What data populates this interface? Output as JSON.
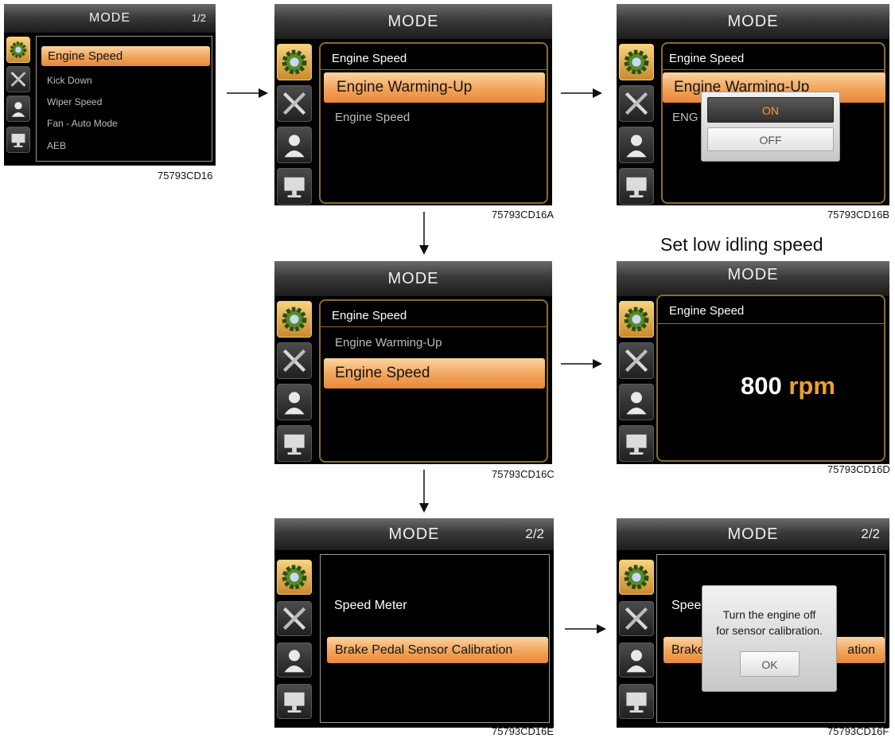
{
  "screen1": {
    "title": "MODE",
    "page": "1/2",
    "items": [
      "Engine Speed",
      "Kick Down",
      "Wiper Speed",
      "Fan - Auto Mode",
      "AEB"
    ],
    "code": "75793CD16"
  },
  "screen2": {
    "title": "MODE",
    "header": "Engine Speed",
    "items": [
      "Engine Warming-Up",
      "Engine Speed"
    ],
    "code": "75793CD16A"
  },
  "screen3": {
    "title": "MODE",
    "header": "Engine Speed",
    "items": [
      "Engine Warming-Up",
      "ENG"
    ],
    "popup": {
      "on": "ON",
      "off": "OFF"
    },
    "code": "75793CD16B"
  },
  "screen4": {
    "title": "MODE",
    "header": "Engine Speed",
    "items": [
      "Engine Warming-Up",
      "Engine Speed"
    ],
    "code": "75793CD16C"
  },
  "screen5": {
    "caption": "Set low idling speed",
    "title": "MODE",
    "header": "Engine Speed",
    "value": "800",
    "unit": "rpm",
    "code": "75793CD16D"
  },
  "screen6": {
    "title": "MODE",
    "page": "2/2",
    "items": [
      "Speed Meter",
      "Brake Pedal Sensor Calibration"
    ],
    "code": "75793CD16E"
  },
  "screen7": {
    "title": "MODE",
    "page": "2/2",
    "items": [
      "Speed Meter",
      "Brake",
      "ation"
    ],
    "message_line1": "Turn the engine off",
    "message_line2": "for sensor calibration.",
    "ok": "OK",
    "code": "75793CD16F"
  },
  "icons": [
    "gear-icon",
    "wrench-screwdriver-icon",
    "user-icon",
    "monitor-icon"
  ],
  "colors": {
    "highlight": "#f1a45a",
    "panel_border": "#8a6d2e",
    "rpm_unit": "#f0a030"
  }
}
